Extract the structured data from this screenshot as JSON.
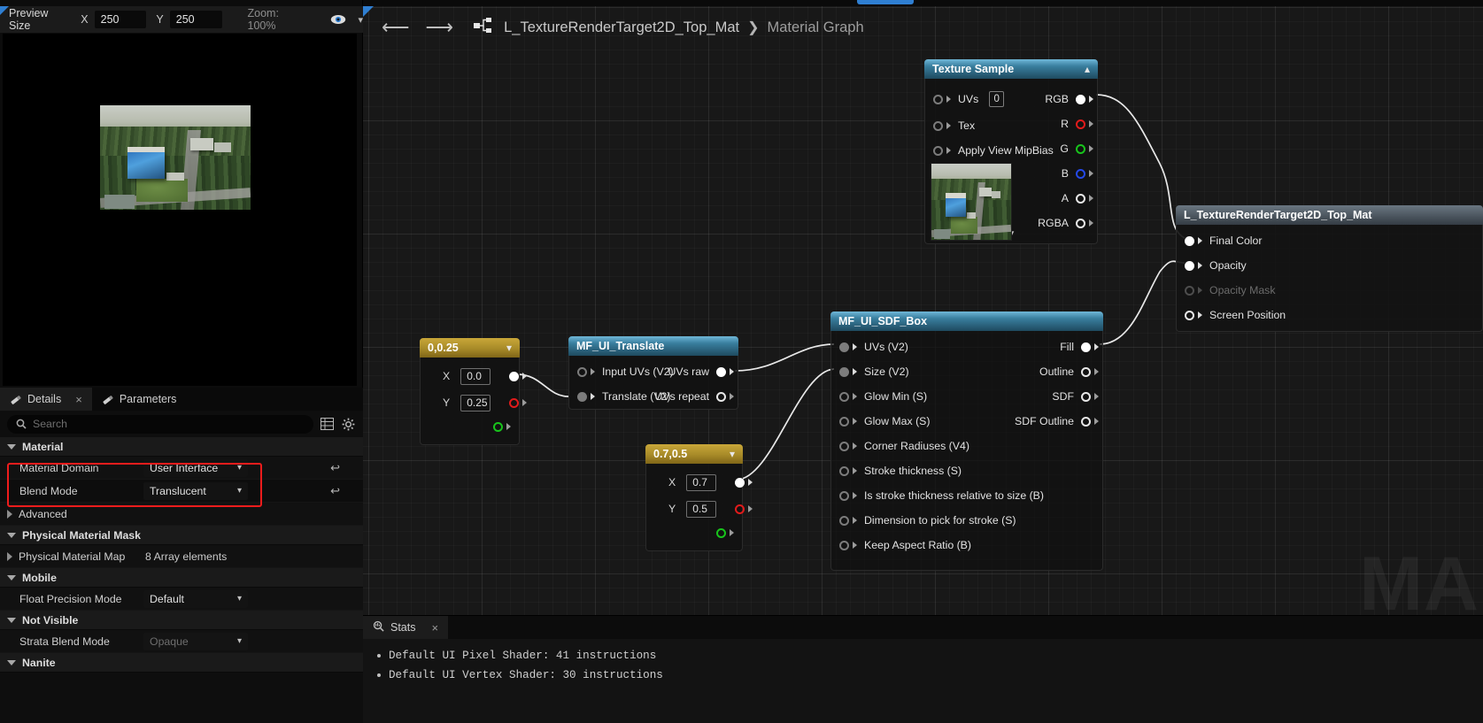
{
  "preview_toolbar": {
    "label": "Preview Size",
    "x_letter": "X",
    "x_value": "250",
    "y_letter": "Y",
    "y_value": "250",
    "zoom": "Zoom: 100%",
    "eye_icon": "eye-icon",
    "chevron_icon": "chevron-down-icon"
  },
  "details": {
    "tabs": [
      {
        "label": "Details",
        "icon": "details-icon",
        "active": true,
        "close": "×"
      },
      {
        "label": "Parameters",
        "icon": "parameters-icon",
        "active": false
      }
    ],
    "search_placeholder": "Search",
    "search_value": "",
    "grid_icon": "grid-view-icon",
    "settings_icon": "gear-icon",
    "reset_icon": "↩",
    "sections": [
      {
        "name": "Material",
        "expanded": true,
        "rows": [
          {
            "name": "Material Domain",
            "type": "combo",
            "value": "User Interface",
            "reset": true,
            "highlighted": true
          },
          {
            "name": "Blend Mode",
            "type": "combo",
            "value": "Translucent",
            "reset": true,
            "highlighted": true
          }
        ]
      },
      {
        "name": "Advanced",
        "expanded": false,
        "sub": true,
        "rows": []
      },
      {
        "name": "Physical Material Mask",
        "expanded": true,
        "rows": [
          {
            "name": "Physical Material Map",
            "type": "text",
            "value": "8 Array elements",
            "collapsible": true
          }
        ]
      },
      {
        "name": "Mobile",
        "expanded": true,
        "rows": [
          {
            "name": "Float Precision Mode",
            "type": "combo",
            "value": "Default"
          }
        ]
      },
      {
        "name": "Not Visible",
        "expanded": true,
        "rows": [
          {
            "name": "Strata Blend Mode",
            "type": "combo",
            "value": "Opaque",
            "disabled": true
          }
        ]
      },
      {
        "name": "Nanite",
        "expanded": true,
        "rows": []
      }
    ]
  },
  "graph": {
    "back_icon": "arrow-left-icon",
    "forward_icon": "arrow-right-icon",
    "graph_icon": "material-graph-icon",
    "breadcrumb_root": "L_TextureRenderTarget2D_Top_Mat",
    "breadcrumb_sep": "❯",
    "breadcrumb_current": "Material Graph",
    "watermark": "MA"
  },
  "nodes": {
    "texture_sample": {
      "title": "Texture Sample",
      "collapse_icon": "chevron-up-icon",
      "inputs": [
        {
          "label": "UVs",
          "pin": "hollow",
          "badge": "0"
        },
        {
          "label": "Tex",
          "pin": "hollow"
        },
        {
          "label": "Apply View MipBias",
          "pin": "hollow"
        }
      ],
      "outputs": [
        {
          "label": "RGB",
          "pin": "white"
        },
        {
          "label": "R",
          "pin": "red"
        },
        {
          "label": "G",
          "pin": "green"
        },
        {
          "label": "B",
          "pin": "blue"
        },
        {
          "label": "A",
          "pin": "wh-hollow"
        },
        {
          "label": "RGBA",
          "pin": "wh-hollow"
        }
      ],
      "thumbnail": "texture-thumbnail",
      "expand_icon": "chevron-down-icon"
    },
    "const_a": {
      "title": "0,0.25",
      "chevron_icon": "chevron-down-icon",
      "rows": [
        {
          "label": "X",
          "value": "0.0",
          "pin": "white"
        },
        {
          "label": "Y",
          "value": "0.25",
          "pin": "red"
        },
        {
          "label": "",
          "value": "",
          "pin": "green"
        }
      ]
    },
    "translate": {
      "title": "MF_UI_Translate",
      "inputs": [
        {
          "label": "Input UVs (V2)",
          "pin": "hollow"
        },
        {
          "label": "Translate (V2)",
          "pin": "filled"
        }
      ],
      "outputs": [
        {
          "label": "UVs raw",
          "pin": "white"
        },
        {
          "label": "UVs repeat",
          "pin": "wh-hollow"
        }
      ]
    },
    "const_b": {
      "title": "0.7,0.5",
      "chevron_icon": "chevron-down-icon",
      "rows": [
        {
          "label": "X",
          "value": "0.7",
          "pin": "white"
        },
        {
          "label": "Y",
          "value": "0.5",
          "pin": "red"
        },
        {
          "label": "",
          "value": "",
          "pin": "green"
        }
      ]
    },
    "sdf_box": {
      "title": "MF_UI_SDF_Box",
      "inputs": [
        {
          "label": "UVs (V2)",
          "pin": "filled"
        },
        {
          "label": "Size (V2)",
          "pin": "filled"
        },
        {
          "label": "Glow Min (S)",
          "pin": "hollow"
        },
        {
          "label": "Glow Max (S)",
          "pin": "hollow"
        },
        {
          "label": "Corner Radiuses (V4)",
          "pin": "hollow"
        },
        {
          "label": "Stroke thickness (S)",
          "pin": "hollow"
        },
        {
          "label": "Is stroke thickness relative to size (B)",
          "pin": "hollow"
        },
        {
          "label": "Dimension to pick for stroke (S)",
          "pin": "hollow"
        },
        {
          "label": "Keep Aspect Ratio (B)",
          "pin": "hollow"
        }
      ],
      "outputs": [
        {
          "label": "Fill",
          "pin": "white"
        },
        {
          "label": "Outline",
          "pin": "wh-hollow"
        },
        {
          "label": "SDF",
          "pin": "wh-hollow"
        },
        {
          "label": "SDF Outline",
          "pin": "wh-hollow"
        }
      ]
    },
    "result": {
      "title": "L_TextureRenderTarget2D_Top_Mat",
      "inputs": [
        {
          "label": "Final Color",
          "pin": "white",
          "disabled": false
        },
        {
          "label": "Opacity",
          "pin": "white",
          "disabled": false
        },
        {
          "label": "Opacity Mask",
          "pin": "wh-hollow",
          "disabled": true
        },
        {
          "label": "Screen Position",
          "pin": "wh-hollow",
          "disabled": false
        }
      ]
    }
  },
  "stats": {
    "tab_label": "Stats",
    "tab_icon": "stats-icon",
    "close": "×",
    "lines": [
      "Default UI Pixel Shader: 41 instructions",
      "Default UI Vertex Shader: 30 instructions"
    ]
  },
  "colors": {
    "accent_blue": "#2f7fd2",
    "node_header_blue": "#3a7f9f",
    "node_header_gold": "#a78a28",
    "highlight_red": "#ef1c1c",
    "pin_red": "#e11b1b",
    "pin_green": "#18c41c",
    "pin_blue": "#2449e8"
  }
}
